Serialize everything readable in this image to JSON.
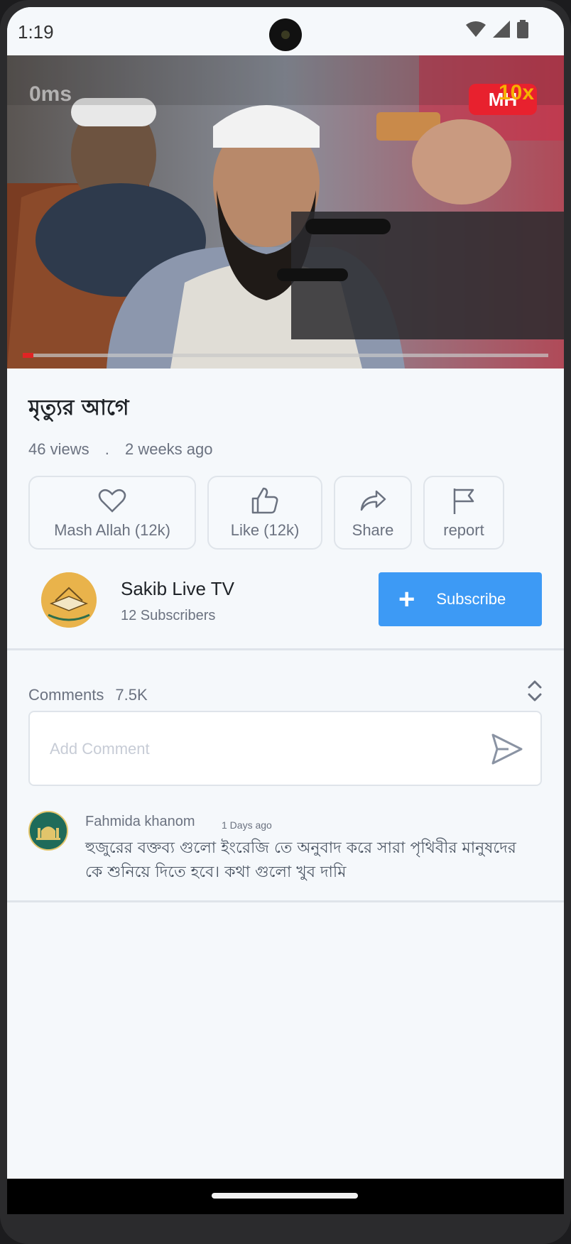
{
  "status_bar": {
    "time": "1:19",
    "icons": [
      "wifi-icon",
      "signal-icon",
      "battery-icon"
    ]
  },
  "video": {
    "overlay_ms": "0ms",
    "logo_text": "MH",
    "speed": "10x",
    "progress_fraction": 0.02
  },
  "title": "মৃত্যুর আগে",
  "meta": {
    "views": "46 views",
    "separator": ".",
    "age": "2 weeks ago"
  },
  "actions": [
    {
      "name": "mash-allah-button",
      "icon": "heart-icon",
      "label": "Mash Allah  (12k)"
    },
    {
      "name": "like-button",
      "icon": "thumbs-up-icon",
      "label": "Like  (12k)"
    },
    {
      "name": "share-button",
      "icon": "share-icon",
      "label": "Share"
    },
    {
      "name": "report-button",
      "icon": "flag-icon",
      "label": "report"
    }
  ],
  "channel": {
    "name": "Sakib Live TV",
    "subscribers": "12 Subscribers",
    "subscribe_label": "Subscribe"
  },
  "comments": {
    "title": "Comments",
    "count": "7.5K",
    "input_placeholder": "Add Comment",
    "items": [
      {
        "author": "Fahmida khanom",
        "time": "1 Days ago",
        "text": "হুজুরের বক্তব্য গুলো ইংরেজি তে অনুবাদ করে সারা পৃথিবীর মানুষদের কে শুনিয়ে দিতে হবে। কথা গুলো খুব দামি"
      }
    ]
  },
  "colors": {
    "accent": "#3d9af5",
    "background": "#f5f8fb",
    "muted_text": "#6b7280",
    "progress": "#e02424"
  }
}
